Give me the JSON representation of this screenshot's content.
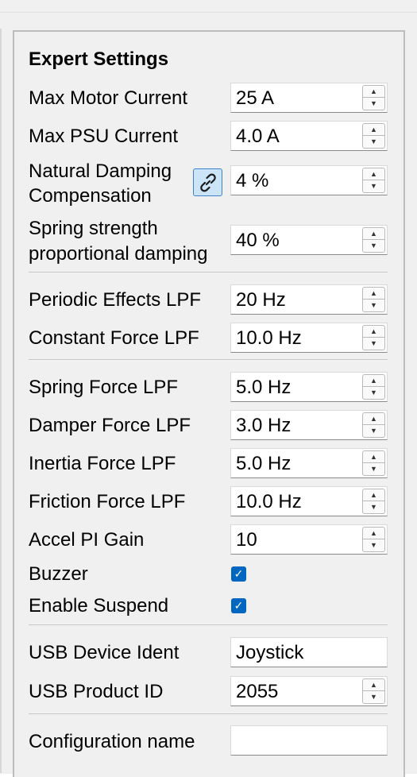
{
  "title": "Expert Settings",
  "fields": {
    "max_motor_current": {
      "label": "Max Motor Current",
      "value": "25 A"
    },
    "max_psu_current": {
      "label": "Max PSU Current",
      "value": "4.0 A"
    },
    "natural_damping": {
      "label_line1": "Natural Damping",
      "label_line2": "Compensation",
      "value": "4 %"
    },
    "spring_strength": {
      "label_line1": "Spring strength",
      "label_line2": "proportional damping",
      "value": "40 %"
    },
    "periodic_effects_lpf": {
      "label": "Periodic Effects LPF",
      "value": "20 Hz"
    },
    "constant_force_lpf": {
      "label": "Constant Force LPF",
      "value": "10.0 Hz"
    },
    "spring_force_lpf": {
      "label": "Spring Force LPF",
      "value": "5.0 Hz"
    },
    "damper_force_lpf": {
      "label": "Damper Force LPF",
      "value": "3.0 Hz"
    },
    "inertia_force_lpf": {
      "label": "Inertia Force LPF",
      "value": "5.0 Hz"
    },
    "friction_force_lpf": {
      "label": "Friction Force LPF",
      "value": "10.0 Hz"
    },
    "accel_pi_gain": {
      "label": "Accel PI Gain",
      "value": "10"
    },
    "buzzer": {
      "label": "Buzzer",
      "checked": true
    },
    "enable_suspend": {
      "label": "Enable Suspend",
      "checked": true
    },
    "usb_device_ident": {
      "label": "USB Device Ident",
      "value": "Joystick"
    },
    "usb_product_id": {
      "label": "USB Product ID",
      "value": "2055"
    },
    "configuration_name": {
      "label": "Configuration name",
      "value": ""
    }
  },
  "icons": {
    "spin_up": "spin-up-arrow",
    "spin_down": "spin-down-arrow",
    "link": "link-chain-icon",
    "check": "checkmark-icon"
  },
  "colors": {
    "checkbox": "#0067c0",
    "link_button_bg": "#cce4f7",
    "link_button_border": "#3d83c9"
  }
}
